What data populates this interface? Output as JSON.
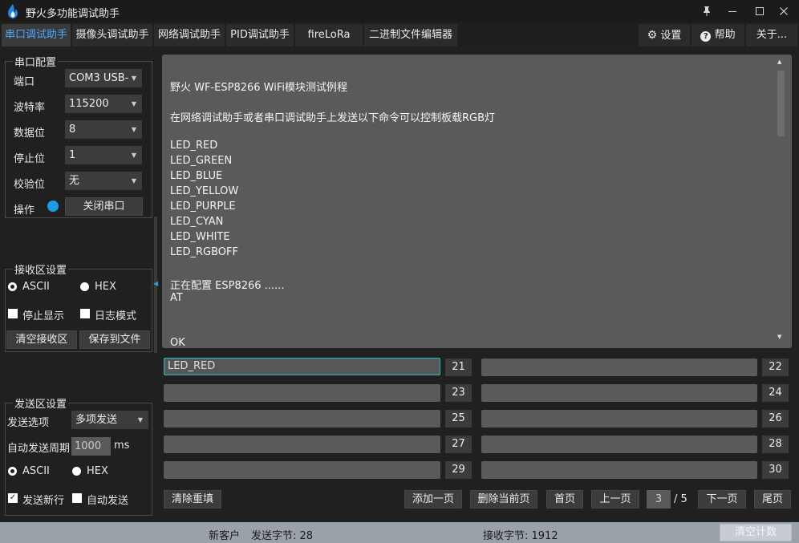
{
  "window": {
    "title": "野火多功能调试助手",
    "controls": [
      "pin-icon",
      "minimize-icon",
      "maximize-icon",
      "close-icon"
    ]
  },
  "tabs": [
    {
      "label": "串口调试助手",
      "active": true
    },
    {
      "label": "摄像头调试助手"
    },
    {
      "label": "网络调试助手"
    },
    {
      "label": "PID调试助手"
    },
    {
      "label": "fireLoRa"
    },
    {
      "label": "二进制文件编辑器"
    }
  ],
  "right_tabs": {
    "settings": {
      "label": "设置",
      "icon": "gear-icon"
    },
    "help": {
      "label": "帮助",
      "icon": "help-icon"
    },
    "about": {
      "label": "关于..."
    }
  },
  "serial_config": {
    "title": "串口配置",
    "port_label": "端口",
    "port_value": "COM3 USB-",
    "baud_label": "波特率",
    "baud_value": "115200",
    "databits_label": "数据位",
    "databits_value": "8",
    "stopbits_label": "停止位",
    "stopbits_value": "1",
    "parity_label": "校验位",
    "parity_value": "无",
    "op_label": "操作",
    "op_button": "关闭串口",
    "status_color": "#1e9be6"
  },
  "recv_settings": {
    "title": "接收区设置",
    "ascii": "ASCII",
    "hex": "HEX",
    "stop_display": "停止显示",
    "log_mode": "日志模式",
    "clear_btn": "清空接收区",
    "save_btn": "保存到文件",
    "ascii_selected": true
  },
  "send_settings": {
    "title": "发送区设置",
    "option_label": "发送选项",
    "option_value": "多项发送",
    "period_label": "自动发送周期",
    "period_value": "1000",
    "period_unit": "ms",
    "ascii": "ASCII",
    "hex": "HEX",
    "newline": "发送新行",
    "auto_send": "自动发送",
    "newline_checked": true
  },
  "recv_text": [
    "野火 WF-ESP8266 WiFi模块测试例程",
    "",
    "在网络调试助手或者串口调试助手上发送以下命令可以控制板载RGB灯",
    "",
    "LED_RED",
    "LED_GREEN",
    "LED_BLUE",
    "LED_YELLOW",
    "LED_PURPLE",
    "LED_CYAN",
    "LED_WHITE",
    "LED_RGBOFF",
    "",
    "正在配置 ESP8266 ......",
    "AT",
    "",
    "",
    "OK"
  ],
  "send_fields": [
    {
      "value": "LED_RED",
      "num": "21"
    },
    {
      "value": "",
      "num": "22"
    },
    {
      "value": "",
      "num": "23"
    },
    {
      "value": "",
      "num": "24"
    },
    {
      "value": "",
      "num": "25"
    },
    {
      "value": "",
      "num": "26"
    },
    {
      "value": "",
      "num": "27"
    },
    {
      "value": "",
      "num": "28"
    },
    {
      "value": "",
      "num": "29"
    },
    {
      "value": "",
      "num": "30"
    }
  ],
  "paging": {
    "clear_refill": "清除重填",
    "add_page": "添加一页",
    "delete_page": "删除当前页",
    "first": "首页",
    "prev": "上一页",
    "current": "3",
    "total": "/ 5",
    "next": "下一页",
    "last": "尾页"
  },
  "status": {
    "client": "新客户",
    "sent": "发送字节: 28",
    "received": "接收字节: 1912",
    "clear_count": "清空计数"
  },
  "colors": {
    "accent": "#4aa8ff",
    "focus_border": "#2ab9c8",
    "statusbar": "#9aa1a8"
  }
}
